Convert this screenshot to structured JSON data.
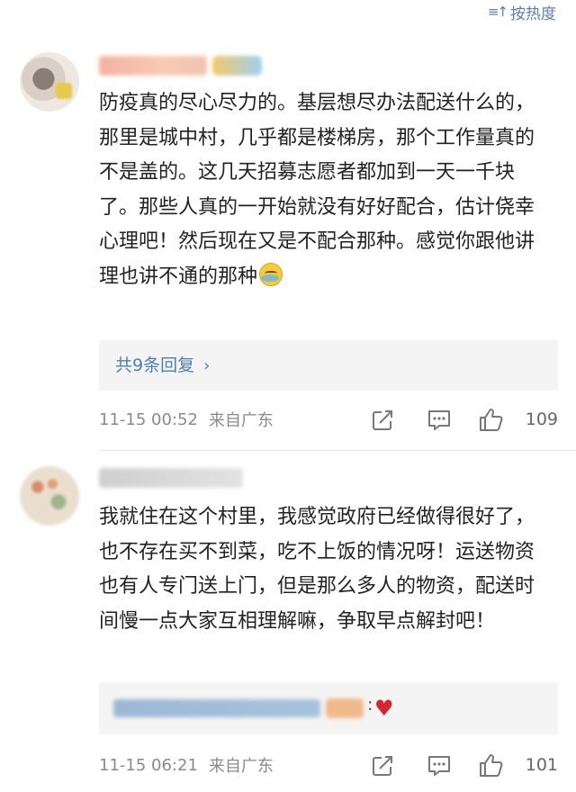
{
  "sort": {
    "icon": "sort-icon",
    "label": "按热度"
  },
  "comments": [
    {
      "text": "防疫真的尽心尽力的。基层想尽办法配送什么的，那里是城中村，几乎都是楼梯房，那个工作量真的不是盖的。这几天招募志愿者都加到一天一千块了。那些人真的一开始就没有好好配合，估计侥幸心理吧！然后现在又是不配合那种。感觉你跟他讲理也讲不通的那种",
      "emoji": "laugh-cry-emoji",
      "reply_summary": "共9条回复",
      "time": "11-15 00:52",
      "location": "来自广东",
      "likes": "109"
    },
    {
      "text": "我就住在这个村里，我感觉政府已经做得很好了，也不存在买不到菜，吃不上饭的情况呀！运送物资也有人专门送上门，但是那么多人的物资，配送时间慢一点大家互相理解嘛，争取早点解封吧！",
      "reply_colon": ":",
      "reply_emoji": "♥",
      "time": "11-15 06:21",
      "location": "来自广东",
      "likes": "101"
    }
  ],
  "colors": {
    "link": "#4e7eb0",
    "meta": "#8a8a8a",
    "heart": "#d9252f"
  }
}
